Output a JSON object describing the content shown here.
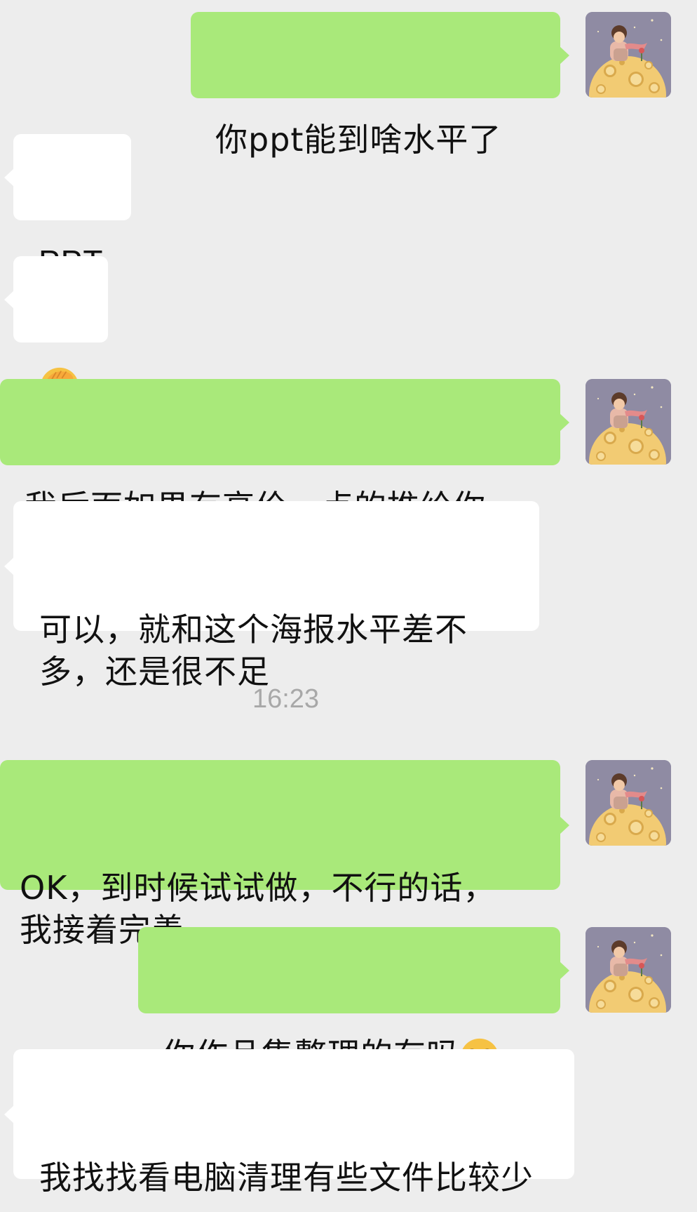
{
  "chat": {
    "messages": [
      {
        "id": "m1",
        "side": "out",
        "text": "你ppt能到啥水平了"
      },
      {
        "id": "m2",
        "side": "in",
        "text": "PPT"
      },
      {
        "id": "m3",
        "side": "in",
        "emoji": "face-palm-emoji"
      },
      {
        "id": "m4",
        "side": "out",
        "text": "我后面如果有高价一点的推给你"
      },
      {
        "id": "m5",
        "side": "in",
        "text": "可以，就和这个海报水平差不多，还是很不足"
      },
      {
        "id": "m6",
        "side": "out",
        "text": "OK，到时候试试做，不行的话，我接着完善"
      },
      {
        "id": "m7",
        "side": "out",
        "text": "你作品集整理的有吗",
        "emoji": "tears-of-joy-emoji"
      },
      {
        "id": "m8",
        "side": "in",
        "text": "我找找看电脑清理有些文件比较少"
      }
    ],
    "timestamp": "16:23"
  },
  "colors": {
    "background": "#ededed",
    "outgoing_bubble": "#a9e97a",
    "incoming_bubble": "#ffffff",
    "timestamp_text": "#a8a8a8"
  },
  "avatar": {
    "icon": "little-prince-on-moon-avatar"
  }
}
